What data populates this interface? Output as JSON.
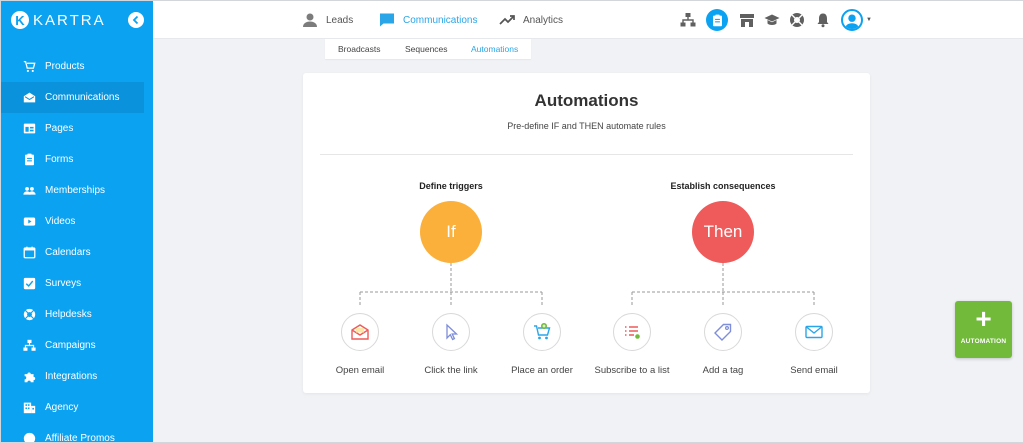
{
  "brand": {
    "name": "KARTRA",
    "mark": "K",
    "accent": "#0ba2f2"
  },
  "sidebar": {
    "items": [
      {
        "label": "Products",
        "icon": "cart-icon"
      },
      {
        "label": "Communications",
        "icon": "envelope-open-icon",
        "active": true
      },
      {
        "label": "Pages",
        "icon": "page-icon"
      },
      {
        "label": "Forms",
        "icon": "clipboard-icon"
      },
      {
        "label": "Memberships",
        "icon": "people-icon"
      },
      {
        "label": "Videos",
        "icon": "video-icon"
      },
      {
        "label": "Calendars",
        "icon": "calendar-icon"
      },
      {
        "label": "Surveys",
        "icon": "checkbox-icon"
      },
      {
        "label": "Helpdesks",
        "icon": "lifebuoy-icon"
      },
      {
        "label": "Campaigns",
        "icon": "sitemap-icon"
      },
      {
        "label": "Integrations",
        "icon": "puzzle-icon"
      },
      {
        "label": "Agency",
        "icon": "building-icon"
      },
      {
        "label": "Affiliate Promos",
        "icon": "affiliate-icon"
      }
    ]
  },
  "topbar": {
    "tabs": [
      {
        "label": "Leads",
        "icon": "person-icon"
      },
      {
        "label": "Communications",
        "icon": "chat-icon",
        "active": true
      },
      {
        "label": "Analytics",
        "icon": "trend-icon"
      }
    ],
    "icons": [
      "sitemap-icon",
      "clipboard-icon",
      "store-icon",
      "graduation-cap-icon",
      "lifebuoy-icon",
      "bell-icon",
      "user-avatar-icon"
    ]
  },
  "subtabs": [
    {
      "label": "Broadcasts"
    },
    {
      "label": "Sequences"
    },
    {
      "label": "Automations",
      "active": true
    }
  ],
  "card": {
    "title": "Automations",
    "subtitle": "Pre-define IF and THEN automate rules",
    "triggers": {
      "heading": "Define triggers",
      "bubble": "If",
      "color": "#fbb03b",
      "options": [
        {
          "label": "Open email",
          "icon": "open-envelope-icon"
        },
        {
          "label": "Click the link",
          "icon": "cursor-icon"
        },
        {
          "label": "Place an order",
          "icon": "cart-add-icon"
        }
      ]
    },
    "consequences": {
      "heading": "Establish consequences",
      "bubble": "Then",
      "color": "#ef5a5a",
      "options": [
        {
          "label": "Subscribe to a list",
          "icon": "list-add-icon"
        },
        {
          "label": "Add a tag",
          "icon": "tag-icon"
        },
        {
          "label": "Send email",
          "icon": "envelope-icon"
        }
      ]
    }
  },
  "fab": {
    "plus": "+",
    "label": "AUTOMATION",
    "color": "#72ba3a"
  }
}
